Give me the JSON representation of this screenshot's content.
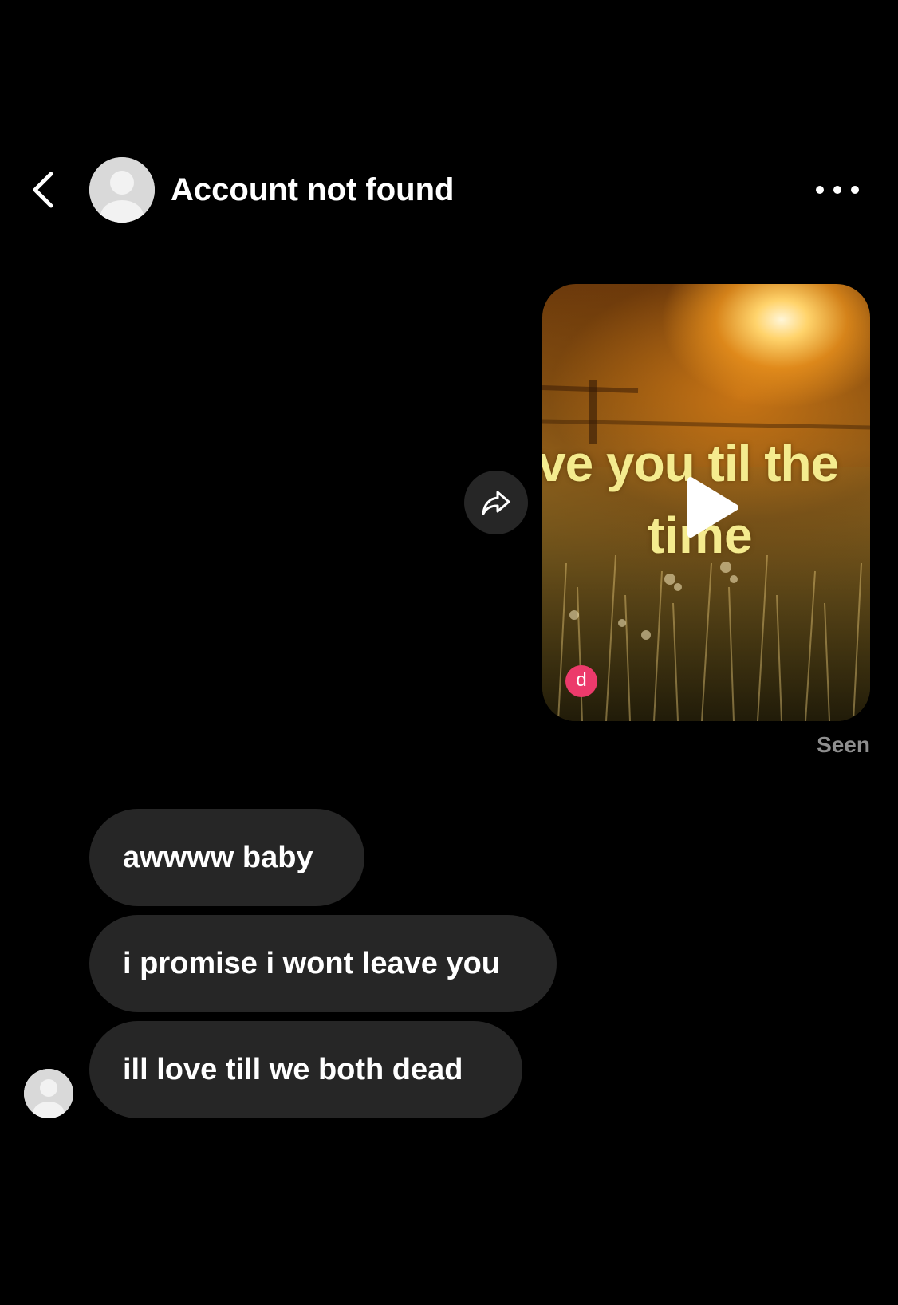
{
  "header": {
    "title": "Account not found",
    "back_icon": "chevron-left-icon",
    "more_icon": "more-horizontal-icon"
  },
  "shared_video": {
    "caption_line_1": "ve you til the",
    "caption_line_2": "time",
    "sender_initial": "d",
    "sender_badge_color": "#ec3a6b"
  },
  "status": {
    "seen": "Seen"
  },
  "messages": [
    {
      "text": "awwww baby"
    },
    {
      "text": "i promise i wont leave you"
    },
    {
      "text": "ill love till we both dead"
    }
  ],
  "colors": {
    "background": "#000000",
    "bubble": "#262626",
    "seen_text": "#8e8e8e",
    "caption_text": "#f4eb8e"
  }
}
